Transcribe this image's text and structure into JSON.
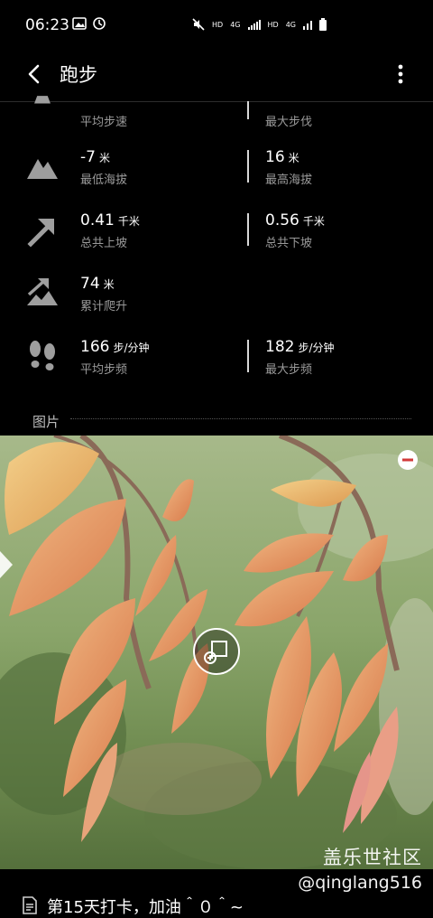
{
  "status": {
    "time": "06:23",
    "right_text_1": "HD",
    "right_text_2": "4G",
    "right_text_3": "HD",
    "right_text_4": "4G"
  },
  "header": {
    "title": "跑步"
  },
  "stats": [
    {
      "icon": "pace-icon",
      "left": {
        "value": "",
        "unit": "",
        "label": "平均步速"
      },
      "right": {
        "value": "",
        "unit": "",
        "label": "最大步伐"
      }
    },
    {
      "icon": "mountain-icon",
      "left": {
        "value": "-7",
        "unit": "米",
        "label": "最低海拔"
      },
      "right": {
        "value": "16",
        "unit": "米",
        "label": "最高海拔"
      }
    },
    {
      "icon": "uphill-arrow-icon",
      "left": {
        "value": "0.41",
        "unit": "千米",
        "label": "总共上坡"
      },
      "right": {
        "value": "0.56",
        "unit": "千米",
        "label": "总共下坡"
      }
    },
    {
      "icon": "climb-icon",
      "left": {
        "value": "74",
        "unit": "米",
        "label": "累计爬升"
      },
      "right": null
    },
    {
      "icon": "footsteps-icon",
      "left": {
        "value": "166",
        "unit": "步/分钟",
        "label": "平均步频"
      },
      "right": {
        "value": "182",
        "unit": "步/分钟",
        "label": "最大步频"
      }
    }
  ],
  "pictures": {
    "section_title": "图片"
  },
  "watermark": {
    "community": "盖乐世社区",
    "handle": "@qinglang516"
  },
  "caption": {
    "text": "第15天打卡，加油＾０＾~"
  }
}
